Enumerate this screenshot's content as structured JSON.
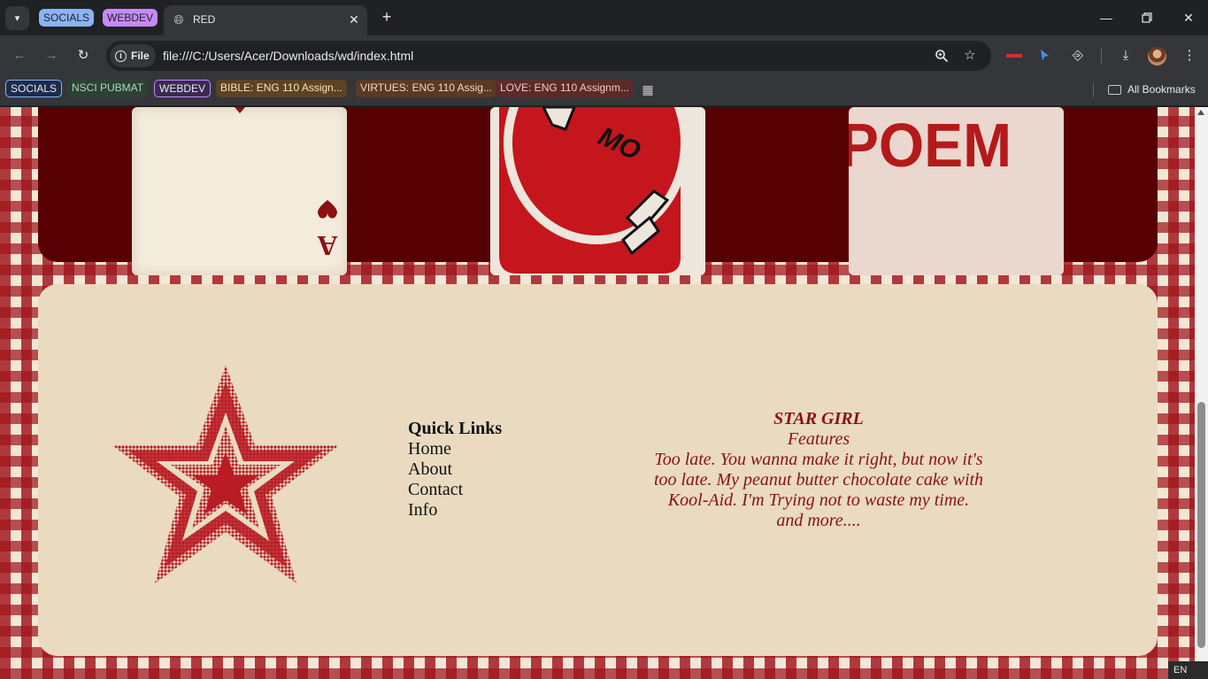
{
  "tabstrip": {
    "tab_groups": [
      {
        "label": "SOCIALS",
        "color": "#8ab4f8"
      },
      {
        "label": "WEBDEV",
        "color": "#c58af9"
      }
    ],
    "active_tab": {
      "title": "RED",
      "icon": "globe-icon"
    },
    "new_tab_icon": "plus-icon",
    "tab_search_icon": "chevron-down-icon",
    "window_controls": [
      "minimize-icon",
      "restore-icon",
      "close-icon"
    ]
  },
  "toolbar": {
    "back_icon": "arrow-left-icon",
    "forward_icon": "arrow-right-icon",
    "reload_icon": "reload-icon",
    "site_info_label": "File",
    "url": "file:///C:/Users/Acer/Downloads/wd/index.html",
    "zoom_icon": "zoom-icon",
    "bookmark_star_icon": "star-icon",
    "extension_icons": [
      "wave-extension-icon",
      "cursor-extension-icon",
      "puzzle-icon"
    ],
    "download_icon": "download-icon",
    "menu_icon": "kebab-menu-icon"
  },
  "bookmarks": {
    "items": [
      {
        "label": "SOCIALS"
      },
      {
        "label": "NSCI PUBMAT"
      },
      {
        "label": "WEBDEV"
      },
      {
        "label": "BIBLE: ENG 110 Assign..."
      },
      {
        "label": "VIRTUES: ENG 110 Assig..."
      },
      {
        "label": "LOVE: ENG 110 Assignm..."
      }
    ],
    "apps_icon": "apps-grid-icon",
    "all_bookmarks_label": "All Bookmarks"
  },
  "page": {
    "colors": {
      "maroon": "#570003",
      "cream": "#e9dac0",
      "text_red": "#8b1113",
      "check_red": "#a0141c"
    },
    "gallery": {
      "cards": [
        {
          "name": "ace-of-hearts-card",
          "text": "A"
        },
        {
          "name": "uno-reverse-card",
          "text": "MO"
        },
        {
          "name": "poem-card",
          "text": "POEM"
        }
      ]
    },
    "footer": {
      "quick_links": {
        "heading": "Quick Links",
        "links": [
          "Home",
          "About",
          "Contact",
          "Info"
        ]
      },
      "feature": {
        "title": "STAR GIRL",
        "subtitle": "Features",
        "lines": [
          "Too late. You wanna make it right, but now it's",
          "too late. My peanut butter chocolate cake with",
          "Kool-Aid. I'm Trying not to waste my time.",
          "and more...."
        ]
      }
    }
  },
  "system": {
    "language": "EN"
  }
}
